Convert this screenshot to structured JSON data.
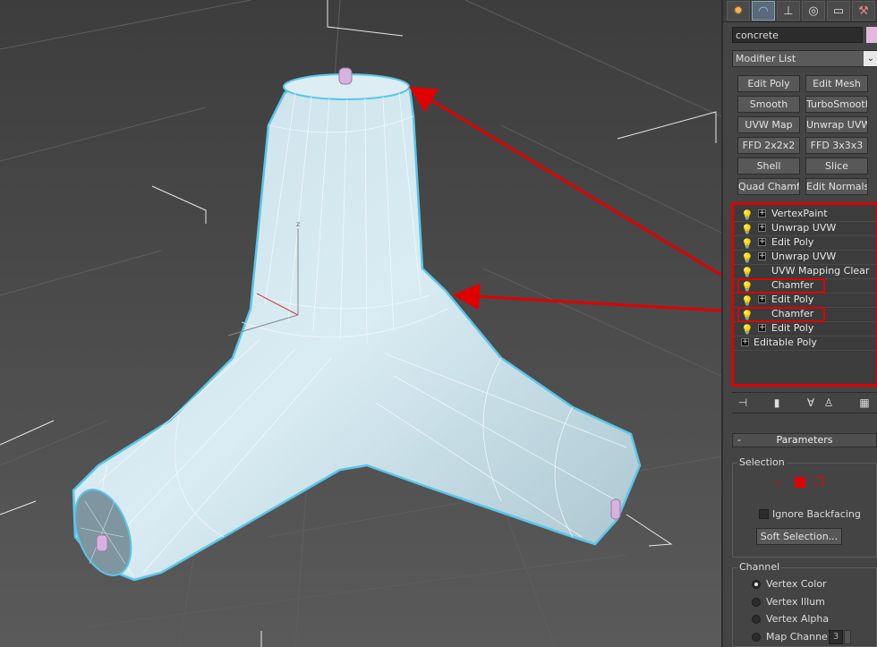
{
  "object_name": "concrete",
  "object_color": "#e2b8dc",
  "modifier_list": "Modifier List",
  "modifier_buttons": [
    "Edit Poly",
    "Edit Mesh",
    "Smooth",
    "TurboSmooth",
    "UVW Map",
    "Unwrap UVW",
    "FFD 2x2x2",
    "FFD 3x3x3",
    "Shell",
    "Slice",
    "Quad Chamfer",
    "Edit Normals"
  ],
  "stack": [
    {
      "label": "VertexPaint",
      "plus": true
    },
    {
      "label": "Unwrap UVW",
      "plus": true
    },
    {
      "label": "Edit Poly",
      "plus": true
    },
    {
      "label": "Unwrap UVW",
      "plus": true
    },
    {
      "label": "UVW Mapping Clear",
      "plus": false
    },
    {
      "label": "Chamfer",
      "plus": false
    },
    {
      "label": "Edit Poly",
      "plus": true
    },
    {
      "label": "Chamfer",
      "plus": false
    },
    {
      "label": "Edit Poly",
      "plus": true
    },
    {
      "label": "Editable Poly",
      "plus": true,
      "base": true
    }
  ],
  "tabs": [
    "create-icon",
    "modify-icon",
    "hierarchy-icon",
    "motion-icon",
    "display-icon",
    "utilities-icon"
  ],
  "parameters": {
    "title": "Parameters",
    "collapse": "-",
    "selection_group": "Selection",
    "ignore_backfacing": "Ignore Backfacing",
    "soft_selection": "Soft Selection...",
    "channel_group": "Channel",
    "channels": [
      "Vertex Color",
      "Vertex Illum",
      "Vertex Alpha",
      "Map Channel"
    ],
    "selected_channel": "Vertex Color",
    "map_channel_value": "3"
  },
  "viewport": {
    "axis_label": "z",
    "annotation_color": "#e00000"
  }
}
